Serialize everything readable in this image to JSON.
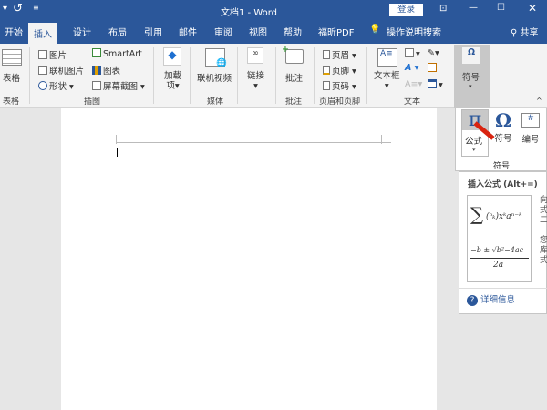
{
  "title_bar": {
    "title": "文档1  -  Word",
    "login": "登录"
  },
  "tabs": [
    "开始",
    "插入",
    "设计",
    "布局",
    "引用",
    "邮件",
    "审阅",
    "视图",
    "帮助",
    "福昕PDF"
  ],
  "tell_me": "操作说明搜索",
  "share": "共享",
  "ribbon": {
    "table": "表格",
    "groups": {
      "table": "表格",
      "illustrations": "插图",
      "media": "媒体",
      "comments": "批注",
      "header_footer": "页眉和页脚",
      "text": "文本"
    },
    "pictures": "图片",
    "online_pictures": "联机图片",
    "shapes": "形状",
    "smartart": "SmartArt",
    "chart": "图表",
    "screenshot": "屏幕截图",
    "addins": "加载",
    "addins2": "项",
    "online_video": "联机视频",
    "links": "链接",
    "comment": "批注",
    "header": "页眉",
    "footer": "页脚",
    "page_number": "页码",
    "textbox": "文本框",
    "symbols": "符号"
  },
  "symbol_panel": {
    "equation": "公式",
    "symbol": "符号",
    "number": "编号",
    "group": "符号"
  },
  "tooltip": {
    "title": "插入公式 (Alt+=)",
    "desc_fragments": [
      "向",
      "式",
      "二",
      "您",
      "库",
      "式"
    ],
    "more_info": "详细信息"
  }
}
